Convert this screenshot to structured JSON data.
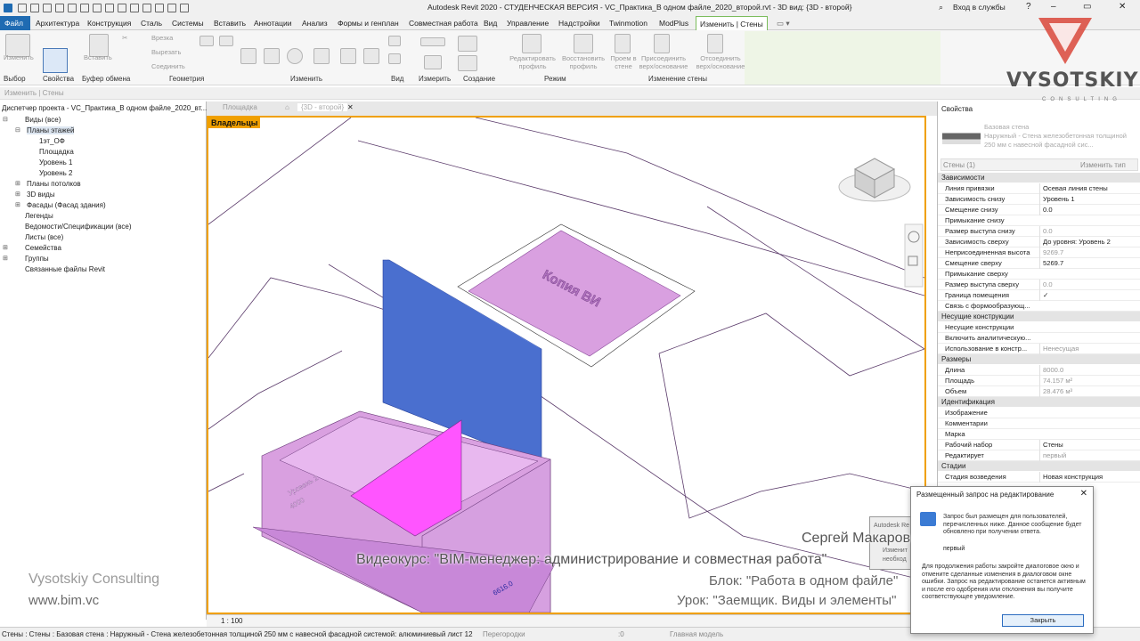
{
  "title_bar": {
    "title": "Autodesk Revit 2020 - СТУДЕНЧЕСКАЯ ВЕРСИЯ - VC_Практика_В одном файле_2020_второй.rvt - 3D вид: {3D - второй}",
    "user": "Вход в службы"
  },
  "ribbon_tabs": [
    "Файл",
    "Архитектура",
    "Конструкция",
    "Сталь",
    "Системы",
    "Вставить",
    "Аннотации",
    "Анализ",
    "Формы и генплан",
    "Совместная работа",
    "Вид",
    "Управление",
    "Надстройки",
    "Twinmotion",
    "ModPlus",
    "Изменить | Стены"
  ],
  "ribbon": {
    "panels": [
      "Выбор",
      "Свойства",
      "Буфер обмена",
      "Геометрия",
      "Изменить",
      "Вид",
      "Измерить",
      "Создание",
      "Режим",
      "Изменение стены"
    ],
    "buttons": {
      "modify": "Изменить",
      "paste": "Вставить",
      "cut_label": "Врезка",
      "cut2_label": "Вырезать",
      "join_label": "Соединить",
      "edit_profile": "Редактировать профиль",
      "reset_profile": "Восстановить профиль",
      "opening_in_wall": "Проем в стене",
      "attach": "Присоединить верх/основание",
      "detach": "Отсоединить верх/основание"
    }
  },
  "options_bar": {
    "text": "Изменить | Стены"
  },
  "project_browser": {
    "title": "Диспетчер проекта - VC_Практика_В одном файле_2020_вт...",
    "items": [
      {
        "label": "Виды (все)",
        "expander": "⊟"
      },
      {
        "label": "Планы этажей",
        "expander": "⊟"
      },
      {
        "label": "1эт_ОФ",
        "expander": ""
      },
      {
        "label": "Площадка",
        "expander": ""
      },
      {
        "label": "Уровень 1",
        "expander": ""
      },
      {
        "label": "Уровень 2",
        "expander": ""
      },
      {
        "label": "Планы потолков",
        "expander": "⊞"
      },
      {
        "label": "3D виды",
        "expander": "⊞"
      },
      {
        "label": "Фасады (Фасад здания)",
        "expander": "⊞"
      },
      {
        "label": "Легенды",
        "expander": ""
      },
      {
        "label": "Ведомости/Спецификации (все)",
        "expander": ""
      },
      {
        "label": "Листы (все)",
        "expander": ""
      },
      {
        "label": "Семейства",
        "expander": "⊞"
      },
      {
        "label": "Группы",
        "expander": "⊞"
      },
      {
        "label": "Связанные файлы Revit",
        "expander": ""
      }
    ]
  },
  "watermark": {
    "company": "Vysotskiy Consulting",
    "site": "www.bim.vc"
  },
  "view_tabs": [
    "Площадка",
    "{3D - второй}"
  ],
  "viewport": {
    "workset_label": "Владельцы",
    "level_label": "Уровень 2",
    "level_value": "4000",
    "dimension": "6616.0",
    "text_3d": "Копия ВИ"
  },
  "view_control_bar": {
    "scale": "1 : 100"
  },
  "properties": {
    "title": "Свойства",
    "type_line1": "Базовая стена",
    "type_line2": "Наружный - Стена железобетонная толщиной 250 мм с навесной фасадной сис...",
    "filter": "Стены (1)",
    "edit_type": "Изменить тип",
    "groups": [
      {
        "name": "Зависимости",
        "rows": [
          {
            "name": "Линия привязки",
            "value": "Осевая линия стены",
            "grey": false
          },
          {
            "name": "Зависимость снизу",
            "value": "Уровень 1",
            "grey": false
          },
          {
            "name": "Смещение снизу",
            "value": "0.0",
            "grey": false
          },
          {
            "name": "Примыкание снизу",
            "value": "",
            "grey": true
          },
          {
            "name": "Размер выступа снизу",
            "value": "0.0",
            "grey": true
          },
          {
            "name": "Зависимость сверху",
            "value": "До уровня: Уровень 2",
            "grey": false
          },
          {
            "name": "Неприсоединенная высота",
            "value": "9269.7",
            "grey": true
          },
          {
            "name": "Смещение сверху",
            "value": "5269.7",
            "grey": false
          },
          {
            "name": "Примыкание сверху",
            "value": "",
            "grey": true
          },
          {
            "name": "Размер выступа сверху",
            "value": "0.0",
            "grey": true
          },
          {
            "name": "Граница помещения",
            "value": "✓",
            "grey": false
          },
          {
            "name": "Связь с формообразующ...",
            "value": "",
            "grey": true
          }
        ]
      },
      {
        "name": "Несущие конструкции",
        "rows": [
          {
            "name": "Несущие конструкции",
            "value": "",
            "grey": false
          },
          {
            "name": "Включить аналитическую...",
            "value": "",
            "grey": true
          },
          {
            "name": "Использование в констр...",
            "value": "Ненесущая",
            "grey": true
          }
        ]
      },
      {
        "name": "Размеры",
        "rows": [
          {
            "name": "Длина",
            "value": "8000.0",
            "grey": true
          },
          {
            "name": "Площадь",
            "value": "74.157 м²",
            "grey": true
          },
          {
            "name": "Объем",
            "value": "28.476 м³",
            "grey": true
          }
        ]
      },
      {
        "name": "Идентификация",
        "rows": [
          {
            "name": "Изображение",
            "value": "",
            "grey": false
          },
          {
            "name": "Комментарии",
            "value": "",
            "grey": false
          },
          {
            "name": "Марка",
            "value": "",
            "grey": false
          },
          {
            "name": "Рабочий набор",
            "value": "Стены",
            "grey": false
          },
          {
            "name": "Редактирует",
            "value": "первый",
            "grey": true
          }
        ]
      },
      {
        "name": "Стадии",
        "rows": [
          {
            "name": "Стадия возведения",
            "value": "Новая конструкция",
            "grey": false
          }
        ]
      }
    ]
  },
  "status_bar": {
    "text": "Стены : Стены : Базовая стена : Наружный - Стена железобетонная толщиной 250 мм с навесной фасадной системой: алюминиевый лист 12",
    "workset": "Перегородки",
    "coord": ":0",
    "model": "Главная модель"
  },
  "dialog": {
    "title": "Размещенный запрос на редактирование",
    "message": "Запрос был размещен для пользователей, перечисленных ниже. Данное сообщение будет обновлено при получении ответа.",
    "user": "первый",
    "note": "Для продолжения работы закройте диалоговое окно и отмените сделанные изменения в диалоговом окне ошибки. Запрос на редактирование останется активным и после его одобрения или отклонения вы получите соответствующее уведомление.",
    "close_button": "Закрыть",
    "behind_title": "Autodesk Re",
    "behind_text1": "Изменит",
    "behind_text2": "необход"
  },
  "overlay": {
    "author": "Сергей Макаров",
    "course": "Видеокурс: \"BIM-менеджер: администрирование и совместная работа\"",
    "block": "Блок: \"Работа в одном файле\"",
    "lesson": "Урок: \"Заемщик. Виды и элементы\""
  },
  "logo": {
    "name": "VYSOTSKIY",
    "sub": "CONSULTING"
  },
  "colors": {
    "file_tab": "#1f6bb2",
    "workset_border": "#f0a000",
    "wall_blue": "#4a6fcf",
    "wall_pink": "#d9a0e0",
    "magenta": "#ff55ff",
    "logo_red": "#d9473a"
  }
}
